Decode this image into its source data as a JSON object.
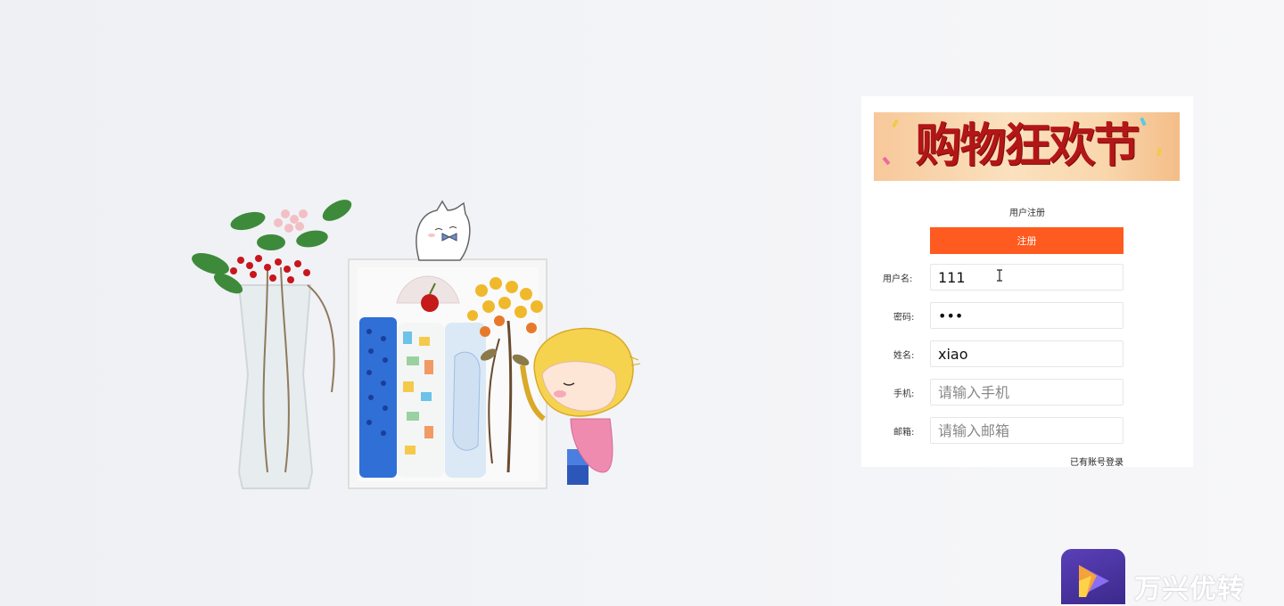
{
  "banner": {
    "title": "购物狂欢节"
  },
  "form": {
    "title": "用户注册",
    "register_button": "注册",
    "fields": {
      "username": {
        "label": "用户名:",
        "value": "111",
        "placeholder": ""
      },
      "password": {
        "label": "密码:",
        "value": "111",
        "placeholder": ""
      },
      "name": {
        "label": "姓名:",
        "value": "xiao",
        "placeholder": ""
      },
      "phone": {
        "label": "手机:",
        "value": "",
        "placeholder": "请输入手机"
      },
      "email": {
        "label": "邮箱:",
        "value": "",
        "placeholder": "请输入邮箱"
      }
    },
    "login_link": "已有账号登录"
  },
  "watermark": {
    "brand_text": "万兴优转",
    "icon": "play-logo-icon"
  },
  "colors": {
    "accent": "#ff5a1f",
    "banner_text": "#b31616",
    "logo": "#4a33a3"
  }
}
